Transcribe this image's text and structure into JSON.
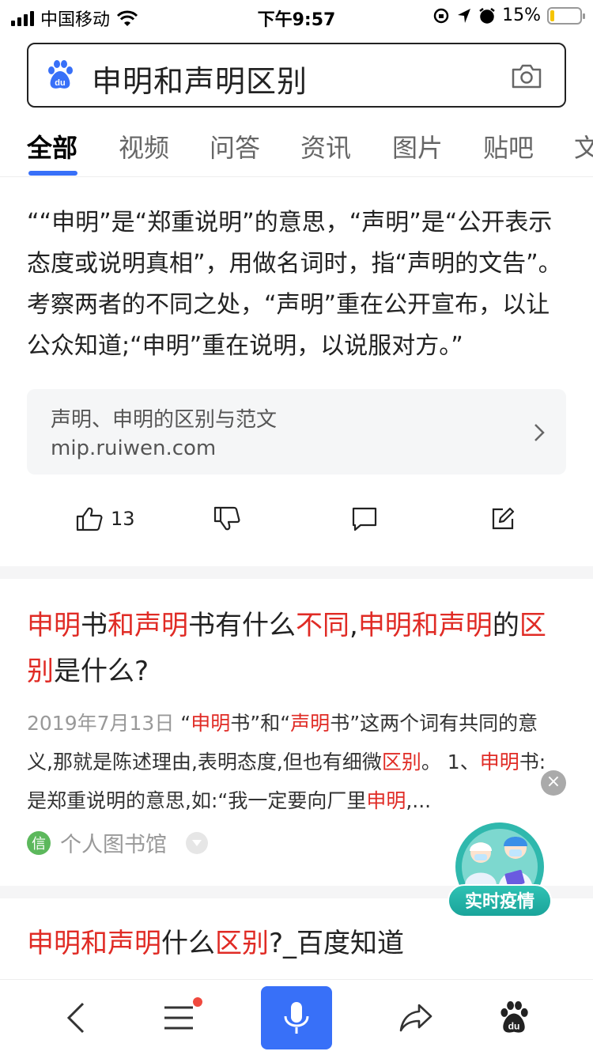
{
  "status_bar": {
    "carrier": "中国移动",
    "time": "下午9:57",
    "battery_percent": "15%",
    "battery_level": 0.15,
    "battery_color": "#f5c400"
  },
  "search": {
    "query": "申明和声明区别",
    "logo_icon": "baidu-paw-icon",
    "camera_icon": "camera-icon"
  },
  "tabs": [
    {
      "label": "全部",
      "active": true
    },
    {
      "label": "视频"
    },
    {
      "label": "问答"
    },
    {
      "label": "资讯"
    },
    {
      "label": "图片"
    },
    {
      "label": "贴吧"
    },
    {
      "label": "文"
    }
  ],
  "answer": {
    "text": "““申明”是“郑重说明”的意思，“声明”是“公开表示态度或说明真相”，用做名词时，指“声明的文告”。考察两者的不同之处，“声明”重在公开宣布，以让公众知道;“申明”重在说明，以说服对方。”",
    "source_title": "声明、申明的区别与范文",
    "source_url": "mip.ruiwen.com",
    "like_count": "13"
  },
  "result1": {
    "title_parts": [
      {
        "t": "申明",
        "hl": true
      },
      {
        "t": "书",
        "hl": false
      },
      {
        "t": "和声明",
        "hl": true
      },
      {
        "t": "书有什么",
        "hl": false
      },
      {
        "t": "不同",
        "hl": true
      },
      {
        "t": ",",
        "hl": false
      },
      {
        "t": "申明和声明",
        "hl": true
      },
      {
        "t": "的",
        "hl": false
      },
      {
        "t": "区别",
        "hl": true
      },
      {
        "t": "是什么?",
        "hl": false
      }
    ],
    "date": "2019年7月13日",
    "snippet_parts": [
      {
        "t": " “",
        "hl": false
      },
      {
        "t": "申明",
        "hl": true
      },
      {
        "t": "书”和“",
        "hl": false
      },
      {
        "t": "声明",
        "hl": true
      },
      {
        "t": "书”这两个词有共同的意义,那就是陈述理由,表明态度,但也有细微",
        "hl": false
      },
      {
        "t": "区别",
        "hl": true
      },
      {
        "t": "。 1、",
        "hl": false
      },
      {
        "t": "申明",
        "hl": true
      },
      {
        "t": "书:是郑重说明的意思,如:“我一定要向厂里",
        "hl": false
      },
      {
        "t": "申明",
        "hl": true
      },
      {
        "t": ",...",
        "hl": false
      }
    ],
    "site_logo": "信",
    "site_name": "个人图书馆"
  },
  "result2": {
    "title_parts": [
      {
        "t": "申明和声明",
        "hl": true
      },
      {
        "t": "什么",
        "hl": false
      },
      {
        "t": "区别",
        "hl": true
      },
      {
        "t": "?_百度知道",
        "hl": false
      }
    ]
  },
  "epidemic_badge": {
    "label": "实时疫情",
    "close": "×"
  },
  "colors": {
    "accent": "#3870f8",
    "highlight": "#e02b25"
  }
}
